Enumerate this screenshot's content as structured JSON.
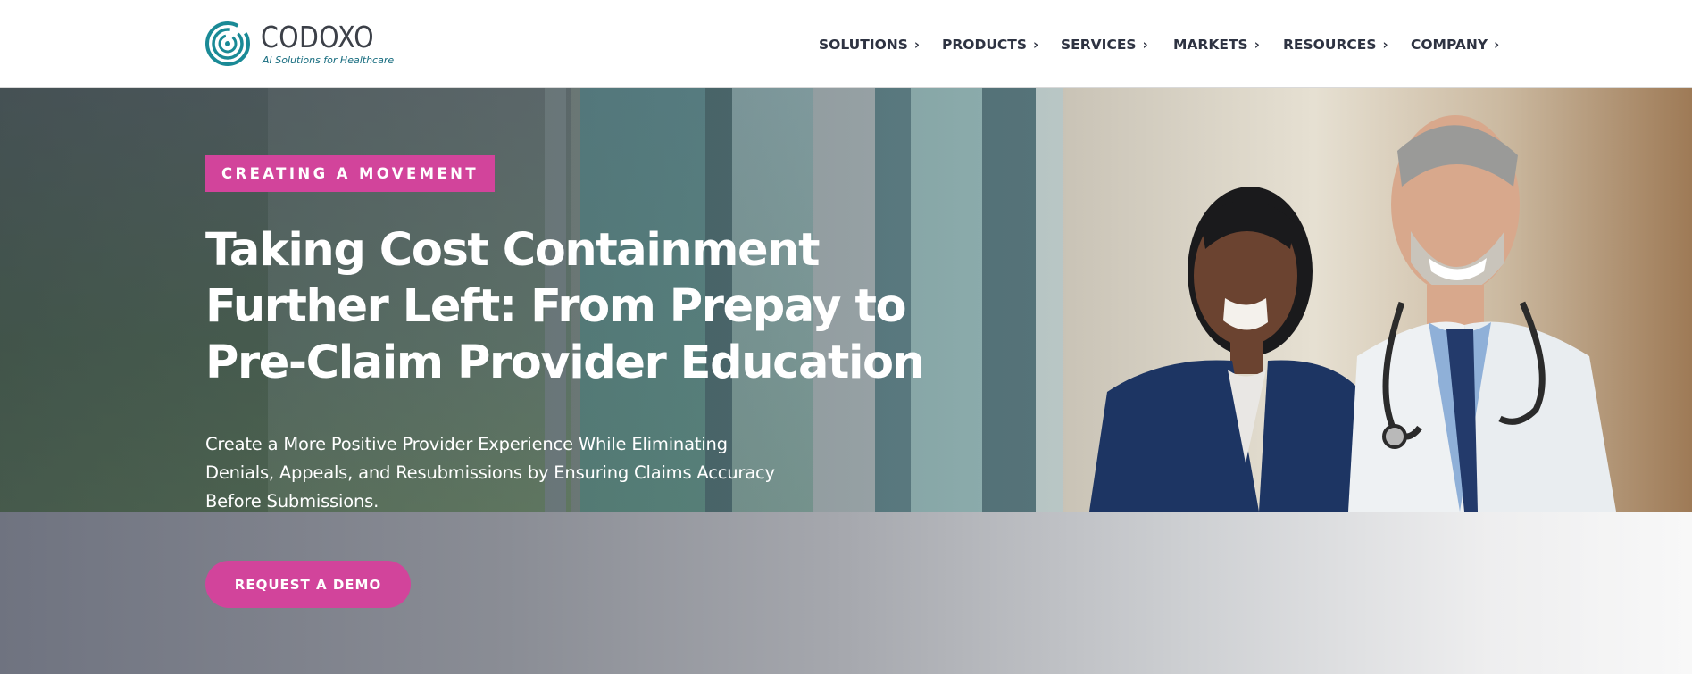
{
  "brand": {
    "name": "CODOXO",
    "tagline": "AI Solutions for Healthcare",
    "logo_color": "#1a8a96"
  },
  "nav": {
    "items": [
      {
        "label": "SOLUTIONS",
        "icon": "chevron-right-icon"
      },
      {
        "label": "PRODUCTS",
        "icon": "chevron-right-icon"
      },
      {
        "label": "SERVICES",
        "icon": "chevron-right-icon"
      },
      {
        "label": "MARKETS",
        "icon": "chevron-right-icon"
      },
      {
        "label": "RESOURCES",
        "icon": "chevron-right-icon"
      },
      {
        "label": "COMPANY",
        "icon": "chevron-right-icon"
      }
    ],
    "chevron": "›"
  },
  "hero": {
    "badge": "CREATING A MOVEMENT",
    "title": "Taking Cost Containment Further Left: From Prepay to Pre-Claim Provider Education",
    "subtitle": "Create a More Positive Provider Experience While Eliminating Denials, Appeals, and Resubmissions by Ensuring Claims Accuracy Before Submissions.",
    "cta_label": "REQUEST A DEMO",
    "image": "photo-two-healthcare-professionals"
  },
  "colors": {
    "accent": "#d2449b",
    "nav_text": "#2e3342",
    "hero_text": "#ffffff"
  }
}
